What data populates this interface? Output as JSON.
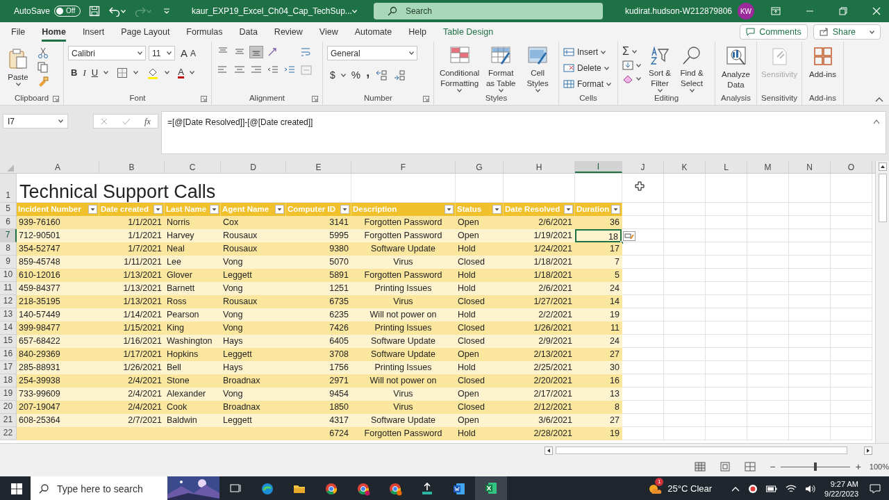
{
  "title_bar": {
    "autosave_label": "AutoSave",
    "autosave_on": false,
    "autosave_state": "Off",
    "filename": "kaur_EXP19_Excel_Ch04_Cap_TechSup...",
    "search_placeholder": "Search",
    "user": "kudirat.hudson-W212879806",
    "avatar_initials": "KW"
  },
  "menu_tabs": [
    {
      "label": "File",
      "selected": false,
      "kind": "standard"
    },
    {
      "label": "Home",
      "selected": true,
      "kind": "standard"
    },
    {
      "label": "Insert",
      "selected": false,
      "kind": "standard"
    },
    {
      "label": "Page Layout",
      "selected": false,
      "kind": "standard"
    },
    {
      "label": "Formulas",
      "selected": false,
      "kind": "standard"
    },
    {
      "label": "Data",
      "selected": false,
      "kind": "standard"
    },
    {
      "label": "Review",
      "selected": false,
      "kind": "standard"
    },
    {
      "label": "View",
      "selected": false,
      "kind": "standard"
    },
    {
      "label": "Automate",
      "selected": false,
      "kind": "standard"
    },
    {
      "label": "Help",
      "selected": false,
      "kind": "standard"
    },
    {
      "label": "Table Design",
      "selected": false,
      "kind": "contextual"
    }
  ],
  "comments_button": "Comments",
  "share_button": "Share",
  "ribbon": {
    "clipboard": {
      "label": "Clipboard",
      "paste": "Paste"
    },
    "font": {
      "label": "Font",
      "name": "Calibri",
      "size": "11",
      "grow": "A",
      "shrink": "A",
      "bold": "B",
      "italic": "I",
      "underline": "U",
      "color_letter": "A"
    },
    "alignment": {
      "label": "Alignment",
      "vertical": [
        {
          "selected": false
        },
        {
          "selected": false
        },
        {
          "selected": true
        }
      ]
    },
    "number": {
      "label": "Number",
      "format": "General",
      "currency": "$",
      "percent": "%",
      "comma": ","
    },
    "styles": {
      "label": "Styles",
      "buttons": [
        {
          "label": "Conditional Formatting"
        },
        {
          "label": "Format as Table"
        },
        {
          "label": "Cell Styles"
        }
      ]
    },
    "cells": {
      "label": "Cells",
      "buttons": [
        "Insert",
        "Delete",
        "Format"
      ]
    },
    "editing": {
      "label": "Editing",
      "sum": "Σ",
      "buttons": [
        {
          "label": "Sort & Filter"
        },
        {
          "label": "Find & Select"
        }
      ]
    },
    "analysis": {
      "label": "Analysis",
      "button": "Analyze Data",
      "disabled": false
    },
    "sensitivity": {
      "label": "Sensitivity",
      "button": "Sensitivity",
      "disabled": true
    },
    "addins": {
      "label": "Add-ins",
      "button": "Add-ins",
      "disabled": false
    }
  },
  "formula_bar": {
    "name_box": "I7",
    "fx": "fx",
    "formula": "=[@[Date Resolved]]-[@[Date created]]"
  },
  "sheet": {
    "columns": [
      {
        "label": "A",
        "selected": false
      },
      {
        "label": "B",
        "selected": false
      },
      {
        "label": "C",
        "selected": false
      },
      {
        "label": "D",
        "selected": false
      },
      {
        "label": "E",
        "selected": false
      },
      {
        "label": "F",
        "selected": false
      },
      {
        "label": "G",
        "selected": false
      },
      {
        "label": "H",
        "selected": false
      },
      {
        "label": "I",
        "selected": true
      },
      {
        "label": "J",
        "selected": false
      },
      {
        "label": "K",
        "selected": false
      },
      {
        "label": "L",
        "selected": false
      },
      {
        "label": "M",
        "selected": false
      },
      {
        "label": "N",
        "selected": false
      },
      {
        "label": "O",
        "selected": false
      }
    ],
    "rows": [
      {
        "number": "1",
        "kind": "title",
        "selected": false,
        "cells": [
          "Technical Support Calls"
        ]
      },
      {
        "number": "5",
        "kind": "header",
        "selected": false,
        "cells": [
          "Incident Number",
          "Date created",
          "Last Name",
          "Agent Name",
          "Computer ID",
          "Description",
          "Status",
          "Date Resolved",
          "Duration"
        ]
      },
      {
        "number": "6",
        "kind": "data",
        "selected": false,
        "cells": [
          "939-76160",
          "1/1/2021",
          "Norris",
          "Cox",
          "3141",
          "Forgotten Password",
          "Open",
          "2/6/2021",
          "36"
        ]
      },
      {
        "number": "7",
        "kind": "data",
        "selected": true,
        "cells": [
          "712-90501",
          "1/1/2021",
          "Harvey",
          "Rousaux",
          "5995",
          "Forgotten Password",
          "Open",
          "1/19/2021",
          "18"
        ]
      },
      {
        "number": "8",
        "kind": "data",
        "selected": false,
        "cells": [
          "354-52747",
          "1/7/2021",
          "Neal",
          "Rousaux",
          "9380",
          "Software Update",
          "Hold",
          "1/24/2021",
          "17"
        ]
      },
      {
        "number": "9",
        "kind": "data",
        "selected": false,
        "cells": [
          "859-45748",
          "1/11/2021",
          "Lee",
          "Vong",
          "5070",
          "Virus",
          "Closed",
          "1/18/2021",
          "7"
        ]
      },
      {
        "number": "10",
        "kind": "data",
        "selected": false,
        "cells": [
          "610-12016",
          "1/13/2021",
          "Glover",
          "Leggett",
          "5891",
          "Forgotten Password",
          "Hold",
          "1/18/2021",
          "5"
        ]
      },
      {
        "number": "11",
        "kind": "data",
        "selected": false,
        "cells": [
          "459-84377",
          "1/13/2021",
          "Barnett",
          "Vong",
          "1251",
          "Printing Issues",
          "Hold",
          "2/6/2021",
          "24"
        ]
      },
      {
        "number": "12",
        "kind": "data",
        "selected": false,
        "cells": [
          "218-35195",
          "1/13/2021",
          "Ross",
          "Rousaux",
          "6735",
          "Virus",
          "Closed",
          "1/27/2021",
          "14"
        ]
      },
      {
        "number": "13",
        "kind": "data",
        "selected": false,
        "cells": [
          "140-57449",
          "1/14/2021",
          "Pearson",
          "Vong",
          "6235",
          "Will not power on",
          "Hold",
          "2/2/2021",
          "19"
        ]
      },
      {
        "number": "14",
        "kind": "data",
        "selected": false,
        "cells": [
          "399-98477",
          "1/15/2021",
          "King",
          "Vong",
          "7426",
          "Printing Issues",
          "Closed",
          "1/26/2021",
          "11"
        ]
      },
      {
        "number": "15",
        "kind": "data",
        "selected": false,
        "cells": [
          "657-68422",
          "1/16/2021",
          "Washington",
          "Hays",
          "6405",
          "Software Update",
          "Closed",
          "2/9/2021",
          "24"
        ]
      },
      {
        "number": "16",
        "kind": "data",
        "selected": false,
        "cells": [
          "840-29369",
          "1/17/2021",
          "Hopkins",
          "Leggett",
          "3708",
          "Software Update",
          "Open",
          "2/13/2021",
          "27"
        ]
      },
      {
        "number": "17",
        "kind": "data",
        "selected": false,
        "cells": [
          "285-88931",
          "1/26/2021",
          "Bell",
          "Hays",
          "1756",
          "Printing Issues",
          "Hold",
          "2/25/2021",
          "30"
        ]
      },
      {
        "number": "18",
        "kind": "data",
        "selected": false,
        "cells": [
          "254-39938",
          "2/4/2021",
          "Stone",
          "Broadnax",
          "2971",
          "Will not power on",
          "Closed",
          "2/20/2021",
          "16"
        ]
      },
      {
        "number": "19",
        "kind": "data",
        "selected": false,
        "cells": [
          "733-99609",
          "2/4/2021",
          "Alexander",
          "Vong",
          "9454",
          "Virus",
          "Open",
          "2/17/2021",
          "13"
        ]
      },
      {
        "number": "20",
        "kind": "data",
        "selected": false,
        "cells": [
          "207-19047",
          "2/4/2021",
          "Cook",
          "Broadnax",
          "1850",
          "Virus",
          "Closed",
          "2/12/2021",
          "8"
        ]
      },
      {
        "number": "21",
        "kind": "data",
        "selected": false,
        "cells": [
          "608-25364",
          "2/7/2021",
          "Baldwin",
          "Leggett",
          "4317",
          "Software Update",
          "Open",
          "3/6/2021",
          "27"
        ]
      },
      {
        "number": "22",
        "kind": "data",
        "selected": false,
        "cells": [
          null,
          null,
          null,
          null,
          "6724",
          "Forgotten Password",
          "Hold",
          "2/28/2021",
          "19"
        ]
      }
    ]
  },
  "status_bar": {
    "zoom_out": "−",
    "zoom_slider": {
      "level": 0.5
    },
    "zoom_in": "+",
    "zoom": "100%"
  },
  "taskbar": {
    "search_placeholder": "Type here to search",
    "apps": [
      {
        "selected": false
      },
      {
        "selected": false
      },
      {
        "selected": false
      },
      {
        "selected": false
      },
      {
        "selected": false
      },
      {
        "selected": false
      },
      {
        "selected": false
      },
      {
        "selected": false
      },
      {
        "selected": true
      }
    ],
    "weather": "25°C Clear",
    "weather_badge": "1",
    "time": "9:27 AM",
    "date": "9/22/2023"
  }
}
